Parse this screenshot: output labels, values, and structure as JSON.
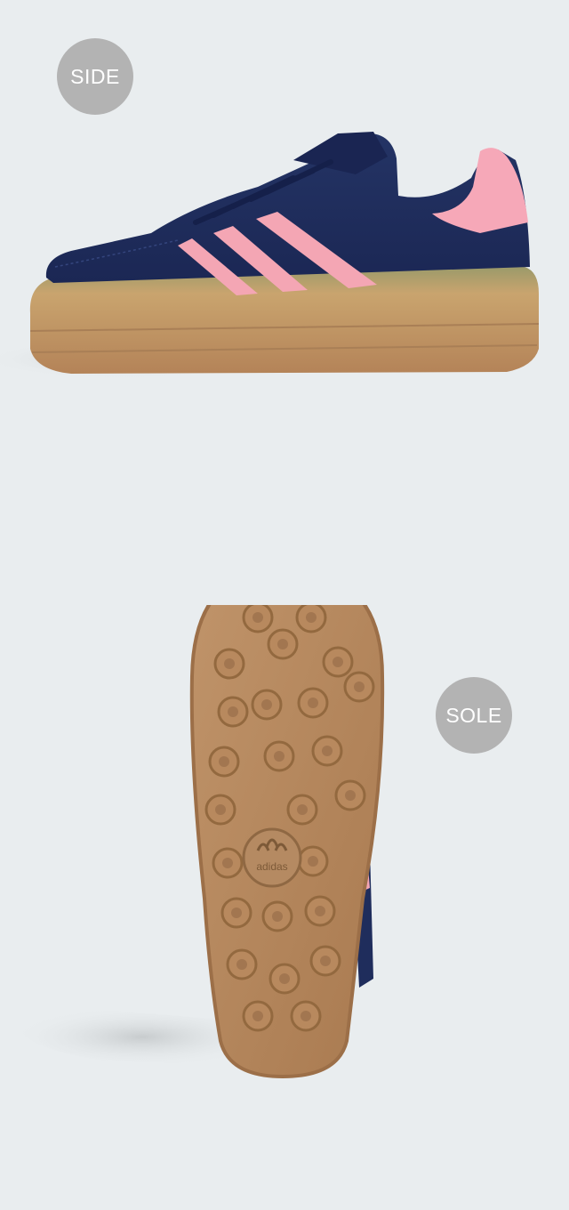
{
  "side": {
    "label": "SIDE"
  },
  "sole": {
    "label": "SOLE",
    "logo_text": "adidas"
  },
  "colors": {
    "background": "#e9edef",
    "badge": "#b3b3b3",
    "upper_navy": "#1f2d5c",
    "stripe_pink": "#f4a6b4",
    "gum_sole": "#b58a62"
  }
}
